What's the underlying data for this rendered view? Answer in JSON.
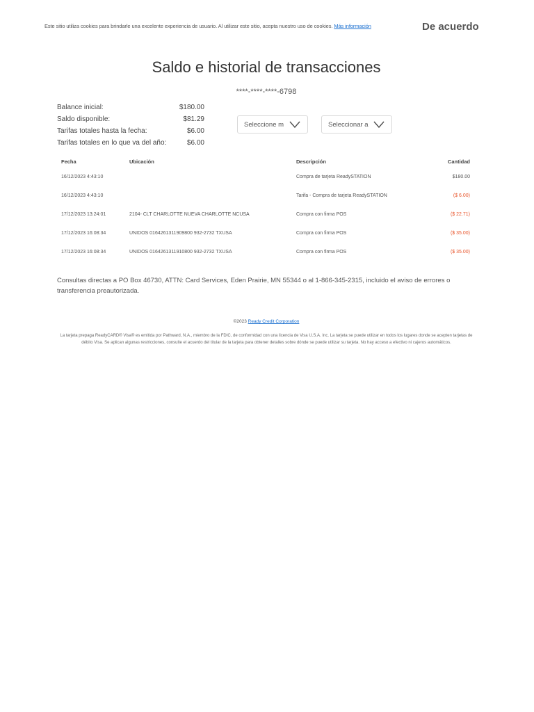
{
  "cookie_bar": {
    "text": "Este sitio utiliza cookies para brindarle una excelente experiencia de usuario. Al utilizar este sitio, acepta nuestro uso de cookies.",
    "link_label": "Más información",
    "agree_label": "De acuerdo",
    "link_color": "#1a6fd0"
  },
  "header": {
    "title": "Saldo e historial de transacciones",
    "card_number": "****-****-****-6798"
  },
  "summary": [
    {
      "label": "Balance inicial:",
      "value": "$180.00"
    },
    {
      "label": "Saldo disponible:",
      "value": "$81.29"
    },
    {
      "label": "Tarifas totales hasta la fecha:",
      "value": "$6.00"
    },
    {
      "label": "Tarifas totales en lo que va del año:",
      "value": "$6.00"
    }
  ],
  "filters": {
    "month_select": "Seleccione m",
    "year_select": "Seleccionar a"
  },
  "table": {
    "headers": {
      "date": "Fecha",
      "location": "Ubicación",
      "description": "Descripción",
      "amount": "Cantidad"
    },
    "rows": [
      {
        "date": "16/12/2023 4:43:10",
        "location": "",
        "description": "Compra de tarjeta ReadySTATION",
        "amount": "$180.00",
        "negative": false
      },
      {
        "date": "16/12/2023 4:43:10",
        "location": "",
        "description": "Tarifa - Compra de tarjeta ReadySTATION",
        "amount": "($ 6.00)",
        "negative": true
      },
      {
        "date": "17/12/2023 13:24:01",
        "location": "2104- CLT CHARLOTTE NUEVA CHARLOTTE NCUSA",
        "description": "Compra con firma POS",
        "amount": "($ 22.71)",
        "negative": true
      },
      {
        "date": "17/12/2023 16:08:34",
        "location": "UNIDOS 0164261311909800 932-2732 TXUSA",
        "description": "Compra con firma POS",
        "amount": "($ 35.00)",
        "negative": true
      },
      {
        "date": "17/12/2023 16:08:34",
        "location": "UNIDOS 0164261311910800 932-2732 TXUSA",
        "description": "Compra con firma POS",
        "amount": "($ 35.00)",
        "negative": true
      }
    ],
    "negative_color": "#e8542a"
  },
  "note": "Consultas directas a PO Box 46730, ATTN: Card Services, Eden Prairie, MN 55344 o al 1-866-345-2315, incluido el aviso de errores o transferencia preautorizada.",
  "footer": {
    "copyright_prefix": "©2023",
    "copyright_link": "Ready Credit Corporation",
    "legal": "La tarjeta prepaga ReadyCARD® Visa® es emitida por Pathward, N.A., miembro de la FDIC, de conformidad con una licencia de Visa U.S.A. Inc. La tarjeta se puede utilizar en todos los lugares donde se acepten tarjetas de débito Visa. Se aplican algunas restricciones, consulte el acuerdo del titular de la tarjeta para obtener detalles sobre dónde se puede utilizar su tarjeta. No hay acceso a efectivo ni cajeros automáticos."
  }
}
